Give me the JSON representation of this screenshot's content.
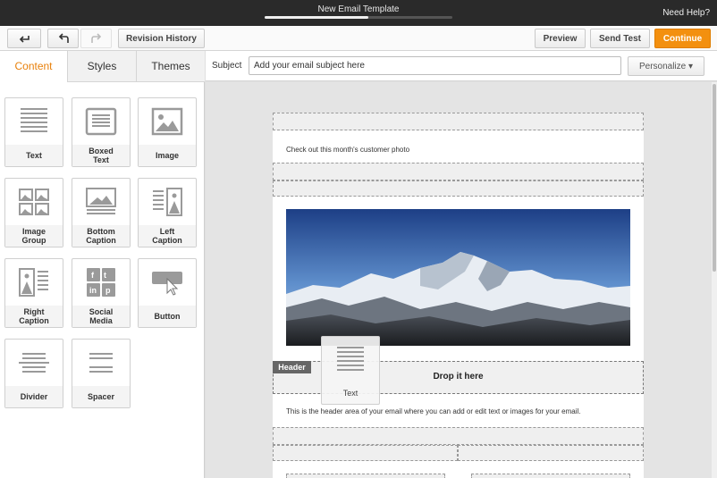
{
  "window": {
    "title": "New Email Template",
    "help": "Need Help?",
    "progress": 0.55
  },
  "toolbar": {
    "undo_nav_icon": "back-arrow-icon",
    "undo_icon": "undo-icon",
    "redo_icon": "redo-icon",
    "revision_history": "Revision History",
    "preview": "Preview",
    "send_test": "Send Test",
    "continue": "Continue",
    "accent_color": "#f3900f"
  },
  "left_panel": {
    "tabs": [
      {
        "label": "Content",
        "active": true
      },
      {
        "label": "Styles",
        "active": false
      },
      {
        "label": "Themes",
        "active": false
      }
    ],
    "blocks": [
      {
        "label": "Text",
        "icon": "text-lines-icon"
      },
      {
        "label": "Boxed\nText",
        "icon": "boxed-text-icon"
      },
      {
        "label": "Image",
        "icon": "image-icon"
      },
      {
        "label": "Image\nGroup",
        "icon": "image-group-icon"
      },
      {
        "label": "Bottom\nCaption",
        "icon": "bottom-caption-icon"
      },
      {
        "label": "Left\nCaption",
        "icon": "left-caption-icon"
      },
      {
        "label": "Right\nCaption",
        "icon": "right-caption-icon"
      },
      {
        "label": "Social\nMedia",
        "icon": "social-media-icon"
      },
      {
        "label": "Button",
        "icon": "button-cursor-icon"
      },
      {
        "label": "Divider",
        "icon": "divider-icon"
      },
      {
        "label": "Spacer",
        "icon": "spacer-icon"
      }
    ]
  },
  "subject": {
    "label": "Subject",
    "value": "Add your email subject here",
    "personalize": "Personalize ▾"
  },
  "email": {
    "preheader_text": "Check out this month's customer photo",
    "header_tag": "Header",
    "drop_text": "Drop it here",
    "header_text": "This is the header area of your email where you can add or edit text or images for your email.",
    "dragging_label": "Text"
  }
}
